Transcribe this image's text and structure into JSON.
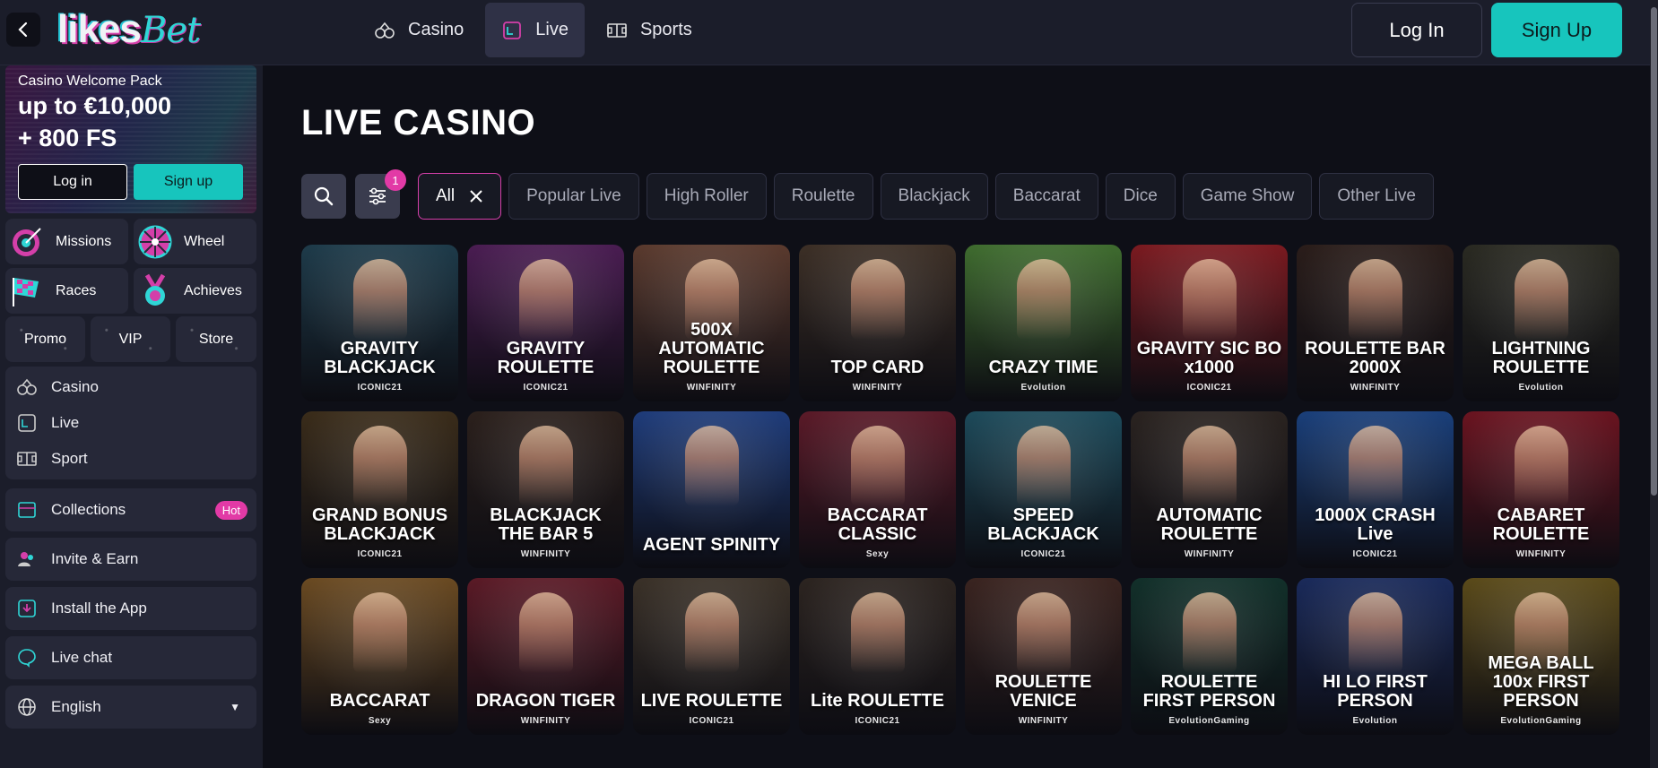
{
  "header": {
    "brand_a": "likes",
    "brand_b": "Bet",
    "nav": [
      {
        "label": "Casino",
        "icon": "casino-icon"
      },
      {
        "label": "Live",
        "icon": "live-icon"
      },
      {
        "label": "Sports",
        "icon": "sports-icon"
      }
    ],
    "login_label": "Log In",
    "signup_label": "Sign Up"
  },
  "sidebar": {
    "promo": {
      "title": "Casino Welcome Pack",
      "line1": "up to €10,000",
      "line2": "+ 800 FS",
      "login_label": "Log in",
      "signup_label": "Sign up"
    },
    "tiles": [
      "Missions",
      "Wheel",
      "Races",
      "Achieves"
    ],
    "small_tiles": [
      "Promo",
      "VIP",
      "Store"
    ],
    "nav": [
      "Casino",
      "Live",
      "Sport"
    ],
    "collections_label": "Collections",
    "hot_badge": "Hot",
    "invite_label": "Invite & Earn",
    "install_label": "Install the App",
    "chat_label": "Live chat",
    "language": "English"
  },
  "main": {
    "title": "LIVE CASINO",
    "filter_count": "1",
    "chips": [
      "All",
      "Popular Live",
      "High Roller",
      "Roulette",
      "Blackjack",
      "Baccarat",
      "Dice",
      "Game Show",
      "Other Live"
    ],
    "games": [
      {
        "title": "GRAVITY BLACKJACK",
        "provider": "ICONIC21",
        "bg": "#1e3b4a"
      },
      {
        "title": "GRAVITY ROULETTE",
        "provider": "ICONIC21",
        "bg": "#4a1d52"
      },
      {
        "title": "500X AUTOMATIC ROULETTE",
        "provider": "WINFINITY",
        "bg": "#5a3a2e"
      },
      {
        "title": "TOP CARD",
        "provider": "WINFINITY",
        "bg": "#3c2f26"
      },
      {
        "title": "CRAZY TIME",
        "provider": "Evolution",
        "bg": "#3f6c2f"
      },
      {
        "title": "GRAVITY SIC BO x1000",
        "provider": "ICONIC21",
        "bg": "#7a1a20"
      },
      {
        "title": "ROULETTE BAR 2000X",
        "provider": "WINFINITY",
        "bg": "#2a1d1a"
      },
      {
        "title": "LIGHTNING ROULETTE",
        "provider": "Evolution",
        "bg": "#2a2a22"
      },
      {
        "title": "GRAND BONUS BLACKJACK",
        "provider": "ICONIC21",
        "bg": "#3a2c1a"
      },
      {
        "title": "BLACKJACK THE BAR 5",
        "provider": "WINFINITY",
        "bg": "#2b201c"
      },
      {
        "title": "AGENT SPINITY",
        "provider": "",
        "bg": "#1f3c7a"
      },
      {
        "title": "BACCARAT CLASSIC",
        "provider": "Sexy",
        "bg": "#5a1a28"
      },
      {
        "title": "SPEED BLACKJACK",
        "provider": "ICONIC21",
        "bg": "#1d4a5a"
      },
      {
        "title": "AUTOMATIC ROULETTE",
        "provider": "WINFINITY",
        "bg": "#2a2320"
      },
      {
        "title": "1000X CRASH Live",
        "provider": "ICONIC21",
        "bg": "#1a3f7a"
      },
      {
        "title": "CABARET ROULETTE",
        "provider": "WINFINITY",
        "bg": "#6a1420"
      },
      {
        "title": "BACCARAT",
        "provider": "Sexy",
        "bg": "#6a4a22"
      },
      {
        "title": "DRAGON TIGER",
        "provider": "WINFINITY",
        "bg": "#5a1a26"
      },
      {
        "title": "LIVE ROULETTE",
        "provider": "ICONIC21",
        "bg": "#3a3128"
      },
      {
        "title": "Lite ROULETTE",
        "provider": "ICONIC21",
        "bg": "#2c2420"
      },
      {
        "title": "ROULETTE VENICE",
        "provider": "WINFINITY",
        "bg": "#3a2420"
      },
      {
        "title": "ROULETTE FIRST PERSON",
        "provider": "EvolutionGaming",
        "bg": "#12302a"
      },
      {
        "title": "HI LO FIRST PERSON",
        "provider": "Evolution",
        "bg": "#1a2a5a"
      },
      {
        "title": "MEGA BALL 100x FIRST PERSON",
        "provider": "EvolutionGaming",
        "bg": "#5a4a1a"
      }
    ]
  },
  "colors": {
    "accent_teal": "#17c5bd",
    "accent_pink": "#e23aa6",
    "background": "#0e0f17",
    "panel": "#1b1d2a"
  }
}
